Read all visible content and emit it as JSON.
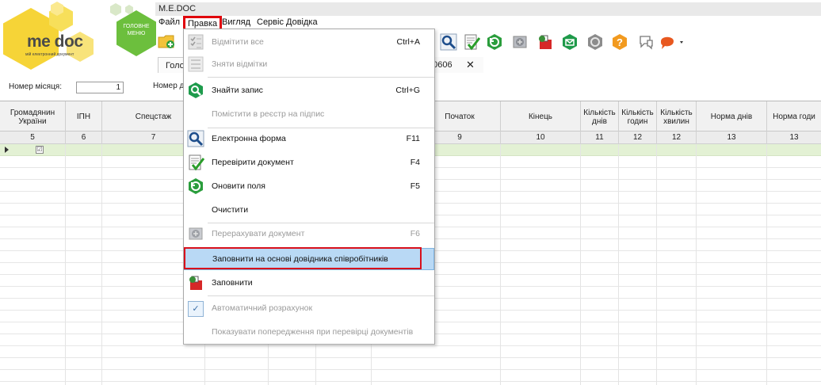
{
  "window": {
    "title": "M.E.DOC"
  },
  "menubar": {
    "file": "Файл",
    "edit": "Правка",
    "view": "Вигляд",
    "service": "Сервіс",
    "help": "Довідка"
  },
  "logo": {
    "text": "me doc",
    "subtitle": "мій електронний документ"
  },
  "home": {
    "label": "ГОЛОВНЕ МЕНЮ"
  },
  "tabs": {
    "main": "Голо",
    "doc": "10606",
    "close": "✕"
  },
  "form": {
    "month_label": "Номер місяця:",
    "month_value": "1",
    "number_label": "Номер д"
  },
  "grid": {
    "headers": [
      "Громадянин України",
      "ІПН",
      "Спецстаж",
      "Початок",
      "Кінець",
      "Кількість днів",
      "Кількість годин",
      "Кількість хвилин",
      "Норма днів",
      "Норма годи"
    ],
    "numbers": [
      "5",
      "6",
      "7",
      "9",
      "10",
      "11",
      "12",
      "12",
      "13",
      "13"
    ],
    "row_check": "☑"
  },
  "dropdown": {
    "items": [
      {
        "label": "Відмітити все",
        "shortcut": "Ctrl+A",
        "enabled": false,
        "icon": "checklist-icon"
      },
      {
        "label": "Зняти відмітки",
        "shortcut": "",
        "enabled": false,
        "icon": "uncheck-list-icon"
      },
      {
        "label": "Знайти запис",
        "shortcut": "Ctrl+G",
        "enabled": true,
        "icon": "find-record-icon"
      },
      {
        "label": "Помістити в реєстр на підпис",
        "shortcut": "",
        "enabled": false,
        "icon": ""
      },
      {
        "label": "Електронна форма",
        "shortcut": "F11",
        "enabled": true,
        "icon": "electronic-form-icon"
      },
      {
        "label": "Перевірити документ",
        "shortcut": "F4",
        "enabled": true,
        "icon": "check-document-icon"
      },
      {
        "label": "Оновити поля",
        "shortcut": "F5",
        "enabled": true,
        "icon": "refresh-fields-icon"
      },
      {
        "label": "Очистити",
        "shortcut": "",
        "enabled": true,
        "icon": ""
      },
      {
        "label": "Перерахувати документ",
        "shortcut": "F6",
        "enabled": false,
        "icon": "recalculate-icon"
      },
      {
        "label": "Заповнити на основі довідника співробітників",
        "shortcut": "",
        "enabled": true,
        "icon": ""
      },
      {
        "label": "Заповнити",
        "shortcut": "",
        "enabled": true,
        "icon": "fill-icon"
      },
      {
        "label": "Автоматичний розрахунок",
        "shortcut": "",
        "enabled": false,
        "icon": "checkmark-icon"
      },
      {
        "label": "Показувати попередження при перевірці документів",
        "shortcut": "",
        "enabled": false,
        "icon": ""
      }
    ],
    "auto_check_mark": "✓"
  },
  "colors": {
    "accent_green": "#6cbf3d",
    "logo_yellow": "#f6d437",
    "highlight_blue": "#b9d9f5",
    "annotation_red": "#d8101c",
    "selected_row": "#e3f1d4"
  }
}
